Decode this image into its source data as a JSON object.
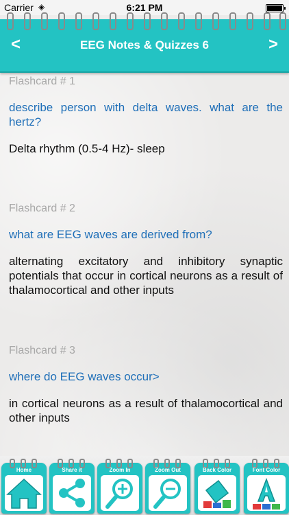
{
  "status": {
    "carrier": "Carrier",
    "time": "6:21 PM"
  },
  "header": {
    "title": "EEG Notes & Quizzes 6",
    "prev": "<",
    "next": ">"
  },
  "cards": [
    {
      "label": "Flashcard # 1",
      "question": "describe person with delta waves. what are the hertz?",
      "answer": "Delta rhythm (0.5-4 Hz)- sleep"
    },
    {
      "label": "Flashcard # 2",
      "question": "what are EEG waves are derived from?",
      "answer": "alternating excitatory and inhibitory synaptic potentials that occur in cortical neurons as a result of thalamocortical and other inputs"
    },
    {
      "label": "Flashcard # 3",
      "question": "where do EEG waves occur>",
      "answer": "in cortical neurons as a result of thalamocortical and other inputs"
    }
  ],
  "toolbar": {
    "home": "Home",
    "share": "Share it",
    "zoom_in": "Zoom In",
    "zoom_out": "Zoom Out",
    "back_color": "Back Color",
    "font_color": "Font Color"
  },
  "icons": {
    "home": "home-icon",
    "share": "share-icon",
    "zoom_in": "zoom-in-icon",
    "zoom_out": "zoom-out-icon",
    "back_color": "paint-bucket-icon",
    "font_color": "letter-a-icon"
  },
  "colors": {
    "accent": "#23c3c3",
    "question": "#1f6fb8",
    "label": "#a8a8a8"
  }
}
